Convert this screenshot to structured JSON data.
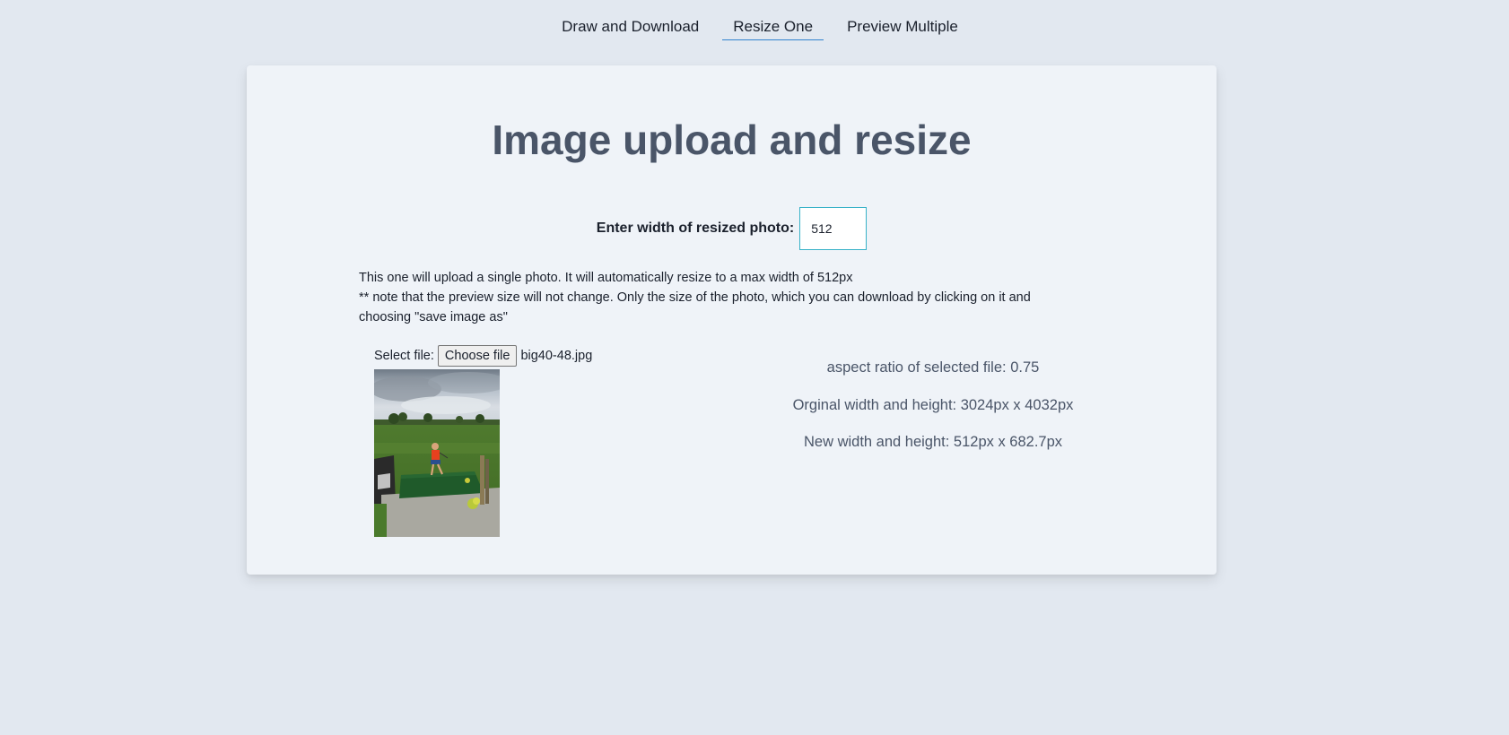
{
  "nav": {
    "tabs": [
      {
        "label": "Draw and Download",
        "active": false
      },
      {
        "label": "Resize One",
        "active": true
      },
      {
        "label": "Preview Multiple",
        "active": false
      }
    ]
  },
  "card": {
    "title": "Image upload and resize",
    "width_label": "Enter width of resized photo:",
    "width_value": "512",
    "description": {
      "line1": "This one will upload a single photo. It will automatically resize to a max width of 512px",
      "line2": "** note that the preview size will not change. Only the size of the photo, which you can download by clicking on it and choosing \"save image as\""
    },
    "file": {
      "label": "Select file:",
      "button_label": "Choose file",
      "filename": "big40-48.jpg"
    },
    "stats": {
      "aspect_ratio": "aspect ratio of selected file: 0.75",
      "original_size": "Orginal width and height: 3024px x 4032px",
      "new_size": "New width and height: 512px x 682.7px"
    }
  },
  "colors": {
    "page_background": "#e2e8f0",
    "card_background": "#eff3f8",
    "title_color": "#4a5568",
    "active_tab_underline": "#3182ce",
    "input_border": "#38b2c8"
  },
  "icons": {
    "preview_image": "golf-driving-range-photo"
  }
}
